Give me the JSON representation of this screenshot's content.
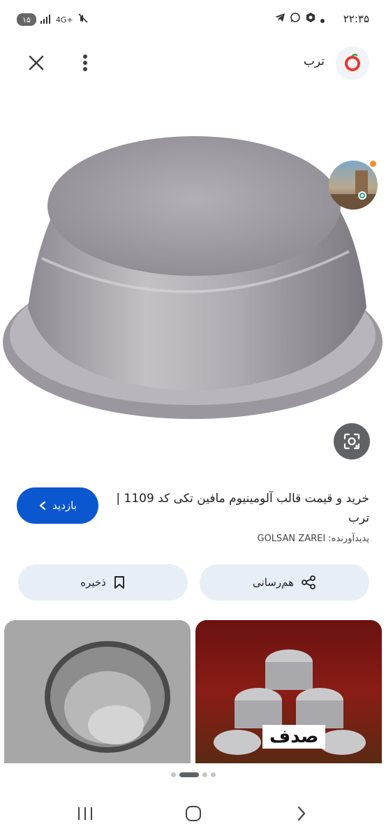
{
  "status_bar": {
    "time": "۲۲:۳۵",
    "battery": "۱۵",
    "network": "4G+"
  },
  "top_bar": {
    "site_name": "ترب",
    "logo_icon": "torob-logo-icon",
    "close_icon": "close-icon",
    "menu_icon": "more-vert-icon"
  },
  "hero": {
    "image": "aluminum-muffin-mold-image",
    "lens_icon": "google-lens-icon"
  },
  "result": {
    "title": "خرید و قیمت قالب آلومینیوم مافین تکی کد 1109 | ترب",
    "creator": "پدیدآورنده: GOLSAN ZAREI",
    "visit_label": "بازدید"
  },
  "actions": {
    "share_label": "هم‌رسانی",
    "save_label": "ذخیره"
  },
  "related": {
    "right_label": "صدف"
  },
  "colors": {
    "primary": "#0b57d0",
    "action_bg": "#e8eef6",
    "logo_red": "#e53935"
  }
}
